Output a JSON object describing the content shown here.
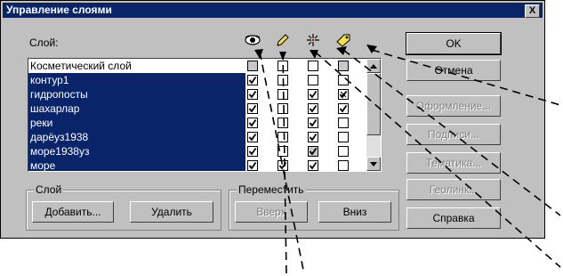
{
  "window": {
    "title": "Управление слоями",
    "close_glyph": "X"
  },
  "layer_list": {
    "header_label": "Слой:",
    "column_icons": [
      "eye-icon",
      "pencil-icon",
      "selection-icon",
      "label-icon"
    ],
    "rows": [
      {
        "name": "Косметический слой",
        "selected": false,
        "visible": "gray",
        "editable": false,
        "selectable": false,
        "labels": "gray"
      },
      {
        "name": "контур1",
        "selected": true,
        "visible": true,
        "editable": false,
        "selectable": false,
        "labels": false
      },
      {
        "name": "гидропосты",
        "selected": true,
        "visible": true,
        "editable": false,
        "selectable": true,
        "labels": true
      },
      {
        "name": "шахарлар",
        "selected": true,
        "visible": true,
        "editable": false,
        "selectable": true,
        "labels": true
      },
      {
        "name": "реки",
        "selected": true,
        "visible": true,
        "editable": false,
        "selectable": true,
        "labels": false
      },
      {
        "name": "дарёуз1938",
        "selected": true,
        "visible": true,
        "editable": false,
        "selectable": true,
        "labels": false
      },
      {
        "name": "море1938уз",
        "selected": true,
        "visible": true,
        "editable": false,
        "selectable": "gray",
        "labels": false
      },
      {
        "name": "море",
        "selected": true,
        "visible": true,
        "editable": true,
        "selectable": true,
        "labels": false
      }
    ]
  },
  "right_buttons": {
    "ok": "OK",
    "cancel": "Отмена",
    "display": "Оформление...",
    "labels": "Подписи...",
    "thematic": "Тематика...",
    "geolink": "Геолинк...",
    "help": "Справка"
  },
  "layer_group": {
    "title": "Слой",
    "add": "Добавить...",
    "remove": "Удалить"
  },
  "move_group": {
    "title": "Переместить",
    "up": "Вверх",
    "down": "Вниз"
  },
  "colors": {
    "dialog_bg": "#c0c0c0",
    "titlebar": "#0a246a",
    "selection": "#0a246a"
  }
}
